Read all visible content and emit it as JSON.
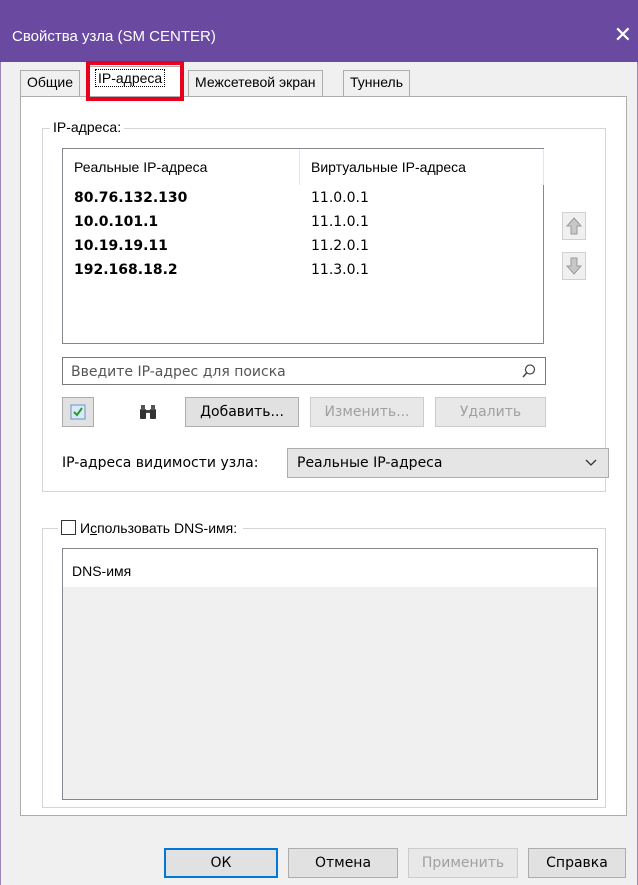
{
  "window": {
    "title": "Свойства узла (SM CENTER)",
    "close_symbol": "✕"
  },
  "tabs": [
    {
      "label": "Общие",
      "active": false
    },
    {
      "label": "IP-адреса",
      "active": true
    },
    {
      "label": "Межсетевой экран",
      "active": false
    },
    {
      "label": "Туннель",
      "active": false
    }
  ],
  "ip_group": {
    "legend": "IP-адреса:",
    "columns": [
      "Реальные IP-адреса",
      "Виртуальные IP-адреса"
    ],
    "rows": [
      {
        "real": "80.76.132.130",
        "virtual": "11.0.0.1"
      },
      {
        "real": "10.0.101.1",
        "virtual": "11.1.0.1"
      },
      {
        "real": "10.19.19.11",
        "virtual": "11.2.0.1"
      },
      {
        "real": "192.168.18.2",
        "virtual": "11.3.0.1"
      }
    ],
    "search_placeholder": "Введите IP-адрес для поиска",
    "add_label": "Добавить...",
    "edit_label": "Изменить...",
    "delete_label": "Удалить",
    "visibility_label": "IP-адреса видимости узла:",
    "visibility_value": "Реальные IP-адреса"
  },
  "dns_group": {
    "checkbox_label_prefix": "И",
    "checkbox_label_accel": "с",
    "checkbox_label_rest": "пользовать DNS-имя:",
    "checked": false,
    "column": "DNS-имя"
  },
  "footer": {
    "ok": "ОК",
    "cancel": "Отмена",
    "apply": "Применить",
    "help": "Справка"
  },
  "colors": {
    "titlebar": "#6a4aa0",
    "highlight": "#e8001c",
    "default_button_border": "#0078d7"
  }
}
